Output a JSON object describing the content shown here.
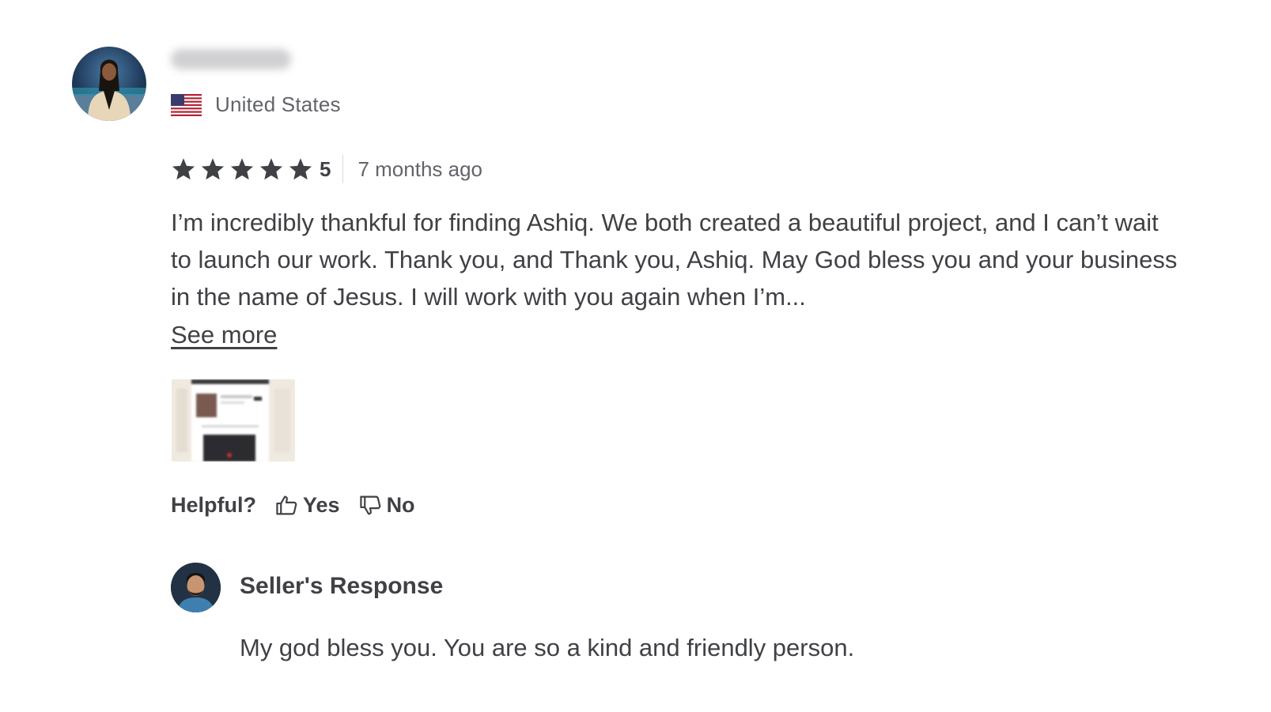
{
  "reviewer": {
    "avatar_icon": "reviewer-avatar",
    "username_blurred": true,
    "country": "United States",
    "flag_icon": "us-flag-icon"
  },
  "rating": {
    "stars": 5,
    "score": "5",
    "time_ago": "7 months ago",
    "star_color": "#404145"
  },
  "review": {
    "text": "I’m incredibly thankful for finding Ashiq. We both created a beautiful project, and I can’t wait to launch our work. Thank you, and Thank you, Ashiq. May God bless you and your business in the name of Jesus. I will work with you again when I’m...",
    "see_more": "See more"
  },
  "helpful": {
    "label": "Helpful?",
    "yes": "Yes",
    "no": "No"
  },
  "seller_response": {
    "title": "Seller's Response",
    "text": "My god bless you. You are so a kind and friendly person."
  },
  "colors": {
    "text_primary": "#404145",
    "text_secondary": "#62646a",
    "divider": "#dadbdd"
  }
}
